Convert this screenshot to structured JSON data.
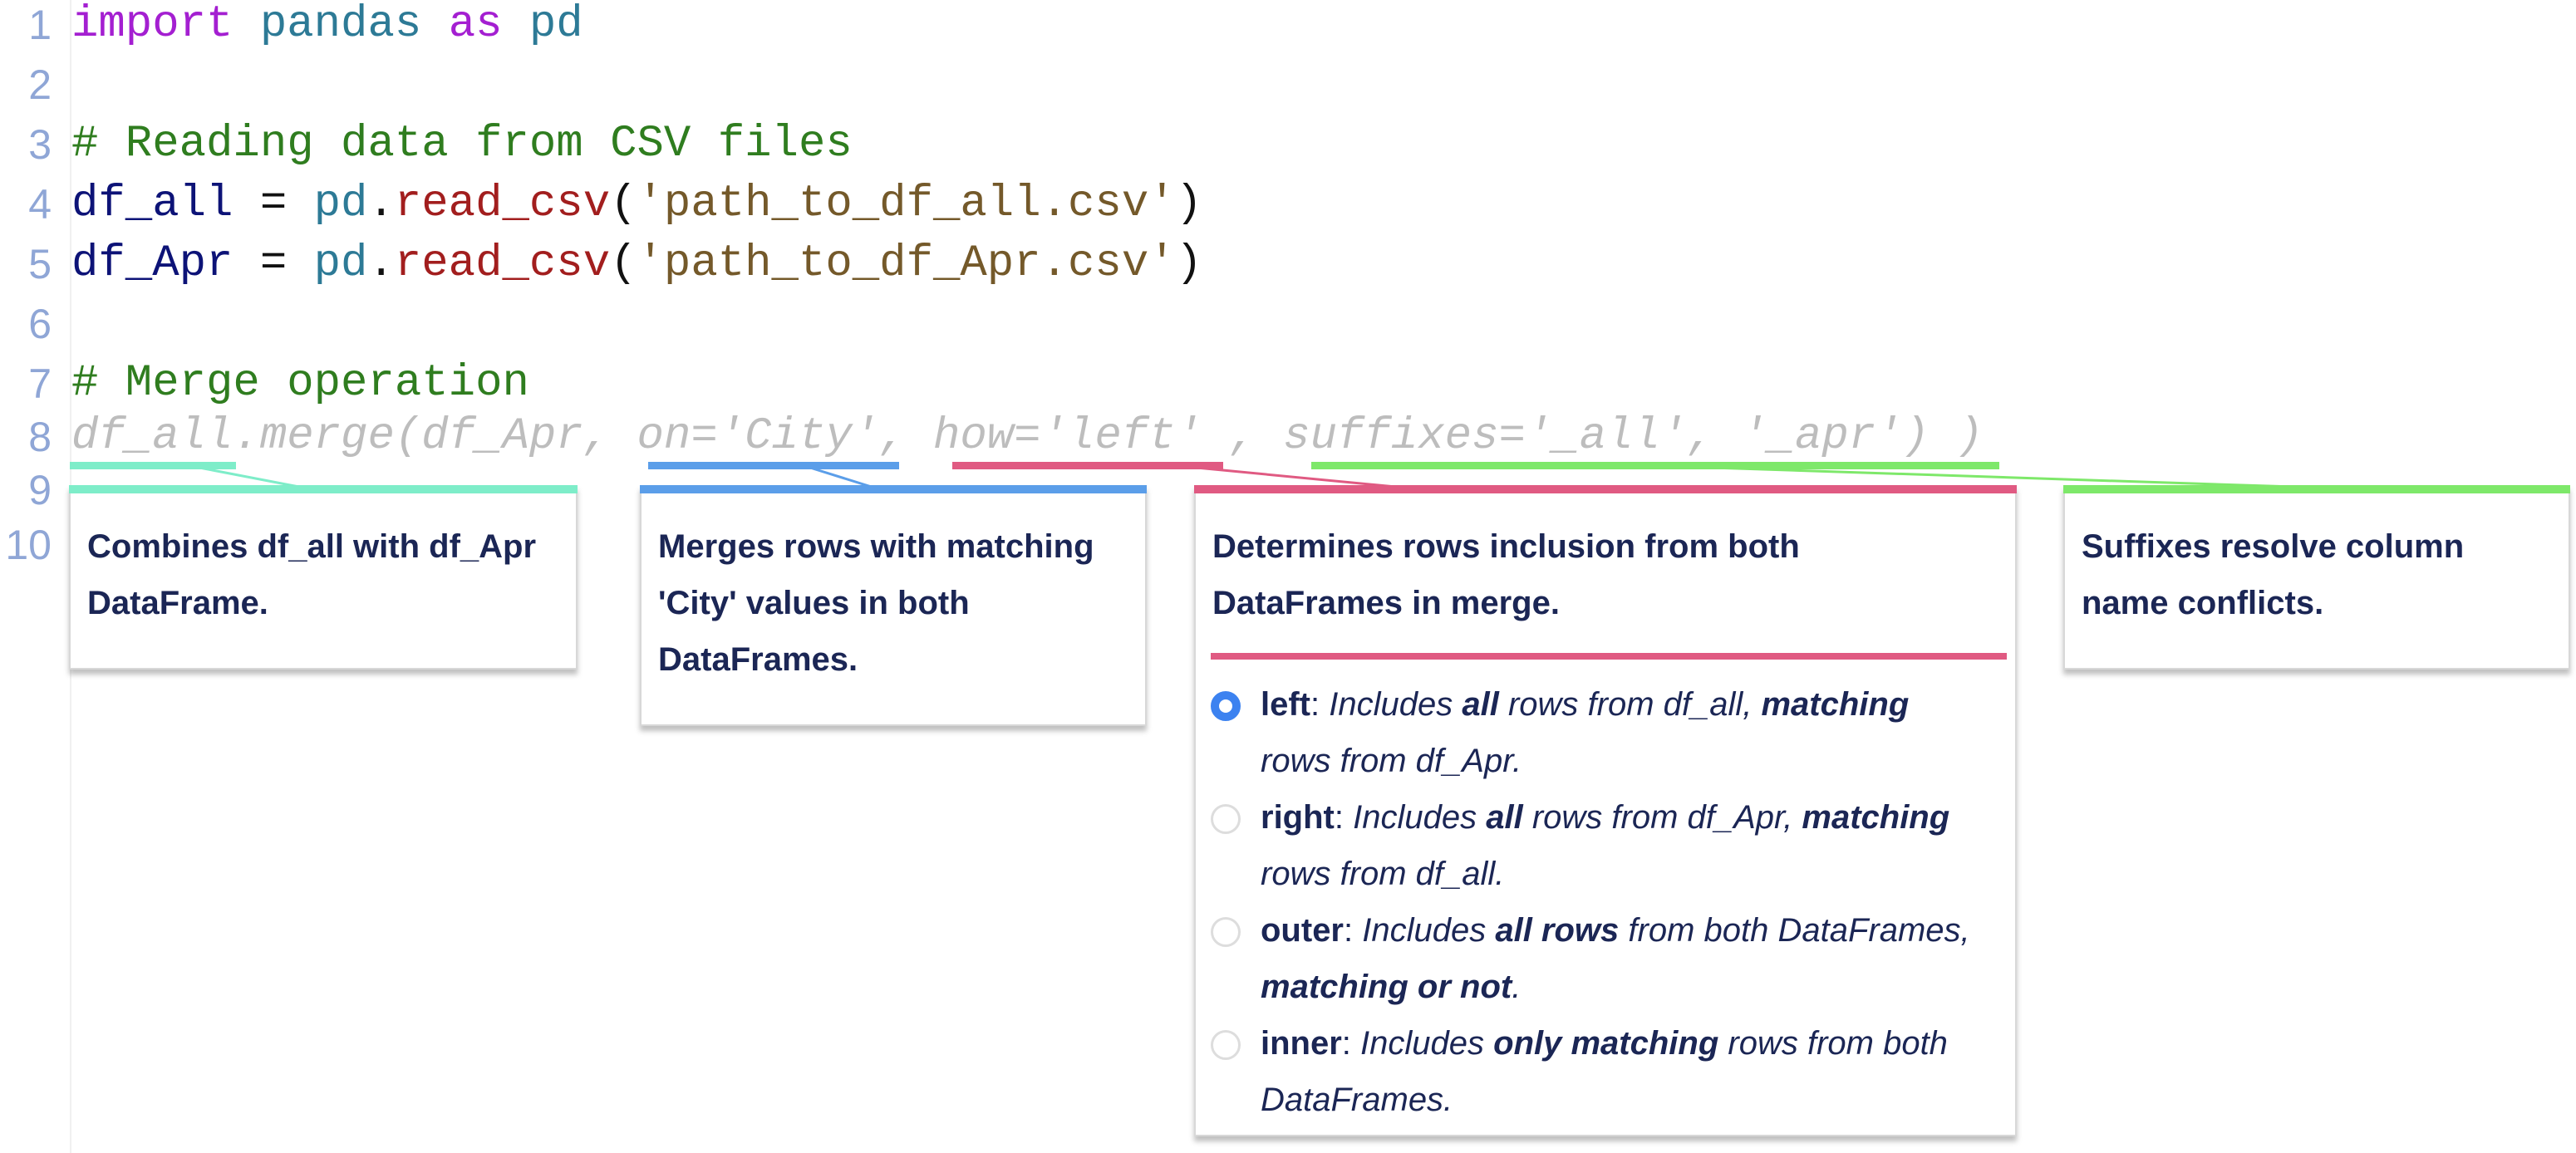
{
  "line_numbers": [
    "1",
    "2",
    "3",
    "4",
    "5",
    "6",
    "7",
    "8",
    "9",
    "10"
  ],
  "code_lines": [
    [
      {
        "t": "import",
        "c": "kw"
      },
      {
        "t": " ",
        "c": "pl"
      },
      {
        "t": "pandas",
        "c": "mod"
      },
      {
        "t": " ",
        "c": "pl"
      },
      {
        "t": "as",
        "c": "kw"
      },
      {
        "t": " ",
        "c": "pl"
      },
      {
        "t": "pd",
        "c": "mod"
      }
    ],
    [],
    [
      {
        "t": "# Reading data from CSV files",
        "c": "cm"
      }
    ],
    [
      {
        "t": "df_all",
        "c": "var"
      },
      {
        "t": " = ",
        "c": "pl"
      },
      {
        "t": "pd",
        "c": "mod"
      },
      {
        "t": ".",
        "c": "pl"
      },
      {
        "t": "read_csv",
        "c": "fn"
      },
      {
        "t": "(",
        "c": "pl"
      },
      {
        "t": "'path_to_df_all.csv'",
        "c": "str"
      },
      {
        "t": ")",
        "c": "pl"
      }
    ],
    [
      {
        "t": "df_Apr",
        "c": "var"
      },
      {
        "t": " = ",
        "c": "pl"
      },
      {
        "t": "pd",
        "c": "mod"
      },
      {
        "t": ".",
        "c": "pl"
      },
      {
        "t": "read_csv",
        "c": "fn"
      },
      {
        "t": "(",
        "c": "pl"
      },
      {
        "t": "'path_to_df_Apr.csv'",
        "c": "str"
      },
      {
        "t": ")",
        "c": "pl"
      }
    ],
    [],
    [
      {
        "t": "# Merge operation",
        "c": "cm"
      }
    ],
    [
      {
        "t": "df_all.merge(df_Apr, on='City', how='left' , suffixes='_all', '_apr') )",
        "c": "ghost"
      }
    ],
    [],
    []
  ],
  "colors": {
    "teal": "#7eedc9",
    "blue": "#5b9ee9",
    "pink": "#e05a82",
    "green": "#7ee86a",
    "text": "#1b2655"
  },
  "annotations": {
    "df_all_merge": "Combines df_all with df_Apr DataFrame.",
    "on": "Merges rows with matching 'City' values in both DataFrames.",
    "how": "Determines rows inclusion from both DataFrames in merge.",
    "suffixes": "Suffixes resolve column name conflicts."
  },
  "how_options": [
    {
      "selected": true,
      "segs": [
        {
          "t": "left",
          "c": "b"
        },
        {
          "t": ": ",
          "c": ""
        },
        {
          "t": "Includes ",
          "c": "i"
        },
        {
          "t": "all",
          "c": "bi"
        },
        {
          "t": " rows from df_all, ",
          "c": "i"
        },
        {
          "t": "matching",
          "c": "bi"
        },
        {
          "t": " rows from df_Apr.",
          "c": "i"
        }
      ]
    },
    {
      "selected": false,
      "segs": [
        {
          "t": "right",
          "c": "b"
        },
        {
          "t": ": ",
          "c": ""
        },
        {
          "t": "Includes ",
          "c": "i"
        },
        {
          "t": "all",
          "c": "bi"
        },
        {
          "t": " rows from df_Apr, ",
          "c": "i"
        },
        {
          "t": "matching",
          "c": "bi"
        },
        {
          "t": " rows from df_all.",
          "c": "i"
        }
      ]
    },
    {
      "selected": false,
      "segs": [
        {
          "t": "outer",
          "c": "b"
        },
        {
          "t": ": ",
          "c": ""
        },
        {
          "t": "Includes ",
          "c": "i"
        },
        {
          "t": "all rows",
          "c": "bi"
        },
        {
          "t": " from both DataFrames, ",
          "c": "i"
        },
        {
          "t": "matching or not",
          "c": "bi"
        },
        {
          "t": ".",
          "c": "i"
        }
      ]
    },
    {
      "selected": false,
      "segs": [
        {
          "t": "inner",
          "c": "b"
        },
        {
          "t": ": ",
          "c": ""
        },
        {
          "t": "Includes ",
          "c": "i"
        },
        {
          "t": "only matching",
          "c": "bi"
        },
        {
          "t": " rows from both DataFrames.",
          "c": "i"
        }
      ]
    }
  ]
}
